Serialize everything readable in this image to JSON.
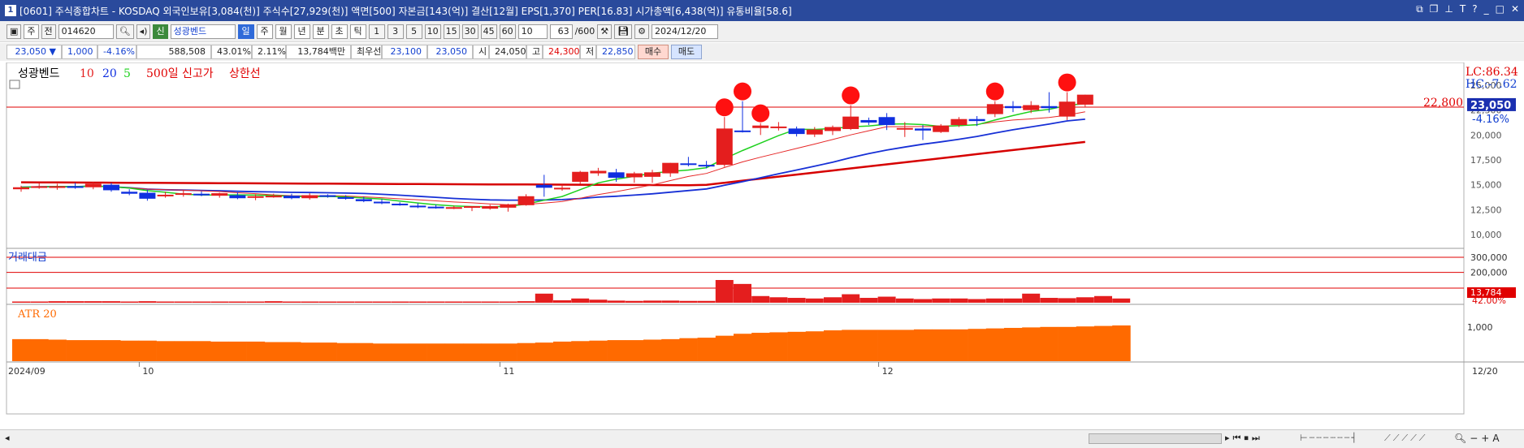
{
  "window": {
    "title": "[0601] 주식종합차트 - KOSDAQ 외국인보유[3,084(천)] 주식수[27,929(천)] 액면[500] 자본금[143(억)] 결산[12월] EPS[1,370] PER[16.83] 시가총액[6,438(억)] 유통비율[58.6]",
    "icon": "1"
  },
  "toolbar": {
    "type_btn": "주",
    "all_btn": "전",
    "code": "014620",
    "sin_label": "신",
    "indicator": "성광벤드",
    "periods": [
      "일",
      "주",
      "월",
      "년",
      "분",
      "초",
      "틱"
    ],
    "active_period": "일",
    "minutes": [
      "1",
      "3",
      "5",
      "10",
      "15",
      "30",
      "45",
      "60"
    ],
    "count_select": "10",
    "page": "63",
    "page_total": "/600",
    "date": "2024/12/20"
  },
  "quote": {
    "price": "23,050 ▼",
    "change": "1,000",
    "change_pct": "-4.16%",
    "volume": "588,508",
    "vol_ratio": "43.01%",
    "turnover": "2.11%",
    "amount": "13,784백만",
    "best_label": "최우선",
    "ask": "23,100",
    "bid": "23,050",
    "open_label": "시",
    "open": "24,050",
    "high_label": "고",
    "high": "24,300",
    "low_label": "저",
    "low": "22,850",
    "buy_btn": "매수",
    "sell_btn": "매도"
  },
  "chart_data": {
    "type": "candlestick",
    "series_labels": [
      "성광벤드",
      "10",
      "20",
      "5",
      "500일 신고가",
      "상한선"
    ],
    "lc": "LC:86.34",
    "hc": "HC:-7.62",
    "y_ticks": [
      25000,
      22500,
      20000,
      17500,
      15000,
      12500,
      10000
    ],
    "price_line": 22800,
    "price_line_label": "22,800",
    "last_price": "23,050",
    "last_pct": "-4.16%",
    "x_labels": [
      {
        "label": "2024/09",
        "index": 0
      },
      {
        "label": "10",
        "index": 7
      },
      {
        "label": "11",
        "index": 27
      },
      {
        "label": "12",
        "index": 48
      },
      {
        "label": "12/20",
        "index": 62
      }
    ],
    "candles": [
      {
        "o": 14550,
        "h": 14900,
        "l": 14300,
        "c": 14750
      },
      {
        "o": 14800,
        "h": 15150,
        "l": 14600,
        "c": 14850
      },
      {
        "o": 14800,
        "h": 15100,
        "l": 14500,
        "c": 14850
      },
      {
        "o": 14850,
        "h": 15200,
        "l": 14600,
        "c": 14800
      },
      {
        "o": 14750,
        "h": 15300,
        "l": 14550,
        "c": 15100
      },
      {
        "o": 15000,
        "h": 15200,
        "l": 14300,
        "c": 14450
      },
      {
        "o": 14300,
        "h": 14550,
        "l": 13950,
        "c": 14100
      },
      {
        "o": 14200,
        "h": 14500,
        "l": 13400,
        "c": 13600
      },
      {
        "o": 13900,
        "h": 14300,
        "l": 13700,
        "c": 14000
      },
      {
        "o": 14100,
        "h": 14450,
        "l": 13800,
        "c": 14150
      },
      {
        "o": 14100,
        "h": 14350,
        "l": 13850,
        "c": 14000
      },
      {
        "o": 13900,
        "h": 14200,
        "l": 13700,
        "c": 14150
      },
      {
        "o": 13950,
        "h": 14250,
        "l": 13550,
        "c": 13650
      },
      {
        "o": 13700,
        "h": 14050,
        "l": 13450,
        "c": 13850
      },
      {
        "o": 13900,
        "h": 14100,
        "l": 13700,
        "c": 13900
      },
      {
        "o": 13900,
        "h": 14100,
        "l": 13550,
        "c": 13650
      },
      {
        "o": 13650,
        "h": 14150,
        "l": 13500,
        "c": 13950
      },
      {
        "o": 13950,
        "h": 14050,
        "l": 13700,
        "c": 13800
      },
      {
        "o": 13750,
        "h": 13950,
        "l": 13500,
        "c": 13600
      },
      {
        "o": 13550,
        "h": 13800,
        "l": 13250,
        "c": 13350
      },
      {
        "o": 13300,
        "h": 13550,
        "l": 13050,
        "c": 13150
      },
      {
        "o": 13100,
        "h": 13250,
        "l": 12900,
        "c": 12950
      },
      {
        "o": 12900,
        "h": 13150,
        "l": 12650,
        "c": 12800
      },
      {
        "o": 12800,
        "h": 13000,
        "l": 12600,
        "c": 12700
      },
      {
        "o": 12700,
        "h": 12900,
        "l": 12550,
        "c": 12750
      },
      {
        "o": 12700,
        "h": 12850,
        "l": 12350,
        "c": 12850
      },
      {
        "o": 12600,
        "h": 13000,
        "l": 12500,
        "c": 12850
      },
      {
        "o": 12700,
        "h": 13100,
        "l": 12300,
        "c": 13000
      },
      {
        "o": 12950,
        "h": 14050,
        "l": 12900,
        "c": 13850
      },
      {
        "o": 15000,
        "h": 16000,
        "l": 13800,
        "c": 14700
      },
      {
        "o": 14700,
        "h": 15000,
        "l": 14400,
        "c": 14700
      },
      {
        "o": 15300,
        "h": 16400,
        "l": 15100,
        "c": 16300
      },
      {
        "o": 16150,
        "h": 16700,
        "l": 15900,
        "c": 16400
      },
      {
        "o": 16250,
        "h": 16600,
        "l": 15300,
        "c": 15700
      },
      {
        "o": 15750,
        "h": 16300,
        "l": 15200,
        "c": 16150
      },
      {
        "o": 15800,
        "h": 16500,
        "l": 15200,
        "c": 16250
      },
      {
        "o": 16150,
        "h": 17200,
        "l": 15800,
        "c": 17200
      },
      {
        "o": 17150,
        "h": 17800,
        "l": 16850,
        "c": 17100
      },
      {
        "o": 17000,
        "h": 17400,
        "l": 16650,
        "c": 16900
      },
      {
        "o": 17000,
        "h": 21800,
        "l": 16800,
        "c": 20650
      },
      {
        "o": 20450,
        "h": 23400,
        "l": 20250,
        "c": 20350
      },
      {
        "o": 20700,
        "h": 21200,
        "l": 20000,
        "c": 20950
      },
      {
        "o": 20750,
        "h": 21300,
        "l": 20450,
        "c": 20850
      },
      {
        "o": 20650,
        "h": 20850,
        "l": 19850,
        "c": 20100
      },
      {
        "o": 20050,
        "h": 20800,
        "l": 19800,
        "c": 20550
      },
      {
        "o": 20400,
        "h": 20950,
        "l": 20000,
        "c": 20800
      },
      {
        "o": 20600,
        "h": 23000,
        "l": 20500,
        "c": 21850
      },
      {
        "o": 21500,
        "h": 21750,
        "l": 21000,
        "c": 21250
      },
      {
        "o": 21800,
        "h": 22200,
        "l": 20500,
        "c": 21000
      },
      {
        "o": 20700,
        "h": 21300,
        "l": 19800,
        "c": 20700
      },
      {
        "o": 20650,
        "h": 21000,
        "l": 19500,
        "c": 20450
      },
      {
        "o": 20300,
        "h": 21100,
        "l": 20200,
        "c": 20950
      },
      {
        "o": 21000,
        "h": 21800,
        "l": 20800,
        "c": 21600
      },
      {
        "o": 21600,
        "h": 21900,
        "l": 20900,
        "c": 21400
      },
      {
        "o": 22100,
        "h": 23400,
        "l": 21800,
        "c": 23100
      },
      {
        "o": 22900,
        "h": 23400,
        "l": 22300,
        "c": 22700
      },
      {
        "o": 22500,
        "h": 23400,
        "l": 22200,
        "c": 23000
      },
      {
        "o": 22900,
        "h": 24300,
        "l": 22250,
        "c": 22700
      },
      {
        "o": 21850,
        "h": 24300,
        "l": 21500,
        "c": 23350
      },
      {
        "o": 23050,
        "h": 24050,
        "l": 22850,
        "c": 24050
      }
    ],
    "highlight_indices": [
      39,
      40,
      41,
      46,
      54,
      58
    ],
    "volume": {
      "label": "거래대금",
      "y_ticks": [
        300000,
        200000
      ],
      "last": "13,784",
      "last_pct": "42.00%",
      "values": [
        4,
        4,
        5,
        5,
        5,
        5,
        4,
        5,
        4,
        4,
        4,
        4,
        4,
        4,
        5,
        4,
        4,
        4,
        4,
        4,
        4,
        4,
        4,
        4,
        4,
        4,
        4,
        4,
        5,
        30,
        8,
        14,
        10,
        7,
        6,
        7,
        7,
        6,
        6,
        75,
        62,
        22,
        18,
        16,
        14,
        18,
        28,
        16,
        20,
        14,
        12,
        14,
        14,
        12,
        14,
        14,
        30,
        16,
        15,
        18,
        22,
        14
      ]
    },
    "atr": {
      "label": "ATR 20",
      "y_tick": "1,000",
      "values": [
        45,
        45,
        44,
        43,
        43,
        43,
        42,
        42,
        41,
        41,
        41,
        40,
        40,
        40,
        39,
        39,
        38,
        38,
        37,
        37,
        36,
        36,
        36,
        36,
        36,
        36,
        36,
        36,
        37,
        38,
        40,
        41,
        42,
        43,
        43,
        44,
        45,
        47,
        48,
        52,
        56,
        58,
        59,
        60,
        61,
        63,
        64,
        64,
        64,
        64,
        65,
        65,
        65,
        66,
        67,
        68,
        69,
        70,
        70,
        71,
        72,
        73
      ]
    }
  },
  "colors": {
    "up": "#e41e1e",
    "down": "#0f2fe0",
    "ma5": "#1fd11f",
    "ma10": "#e62828",
    "ma20": "#1730d6",
    "long": "#d60000",
    "atr": "#ff6a00"
  }
}
